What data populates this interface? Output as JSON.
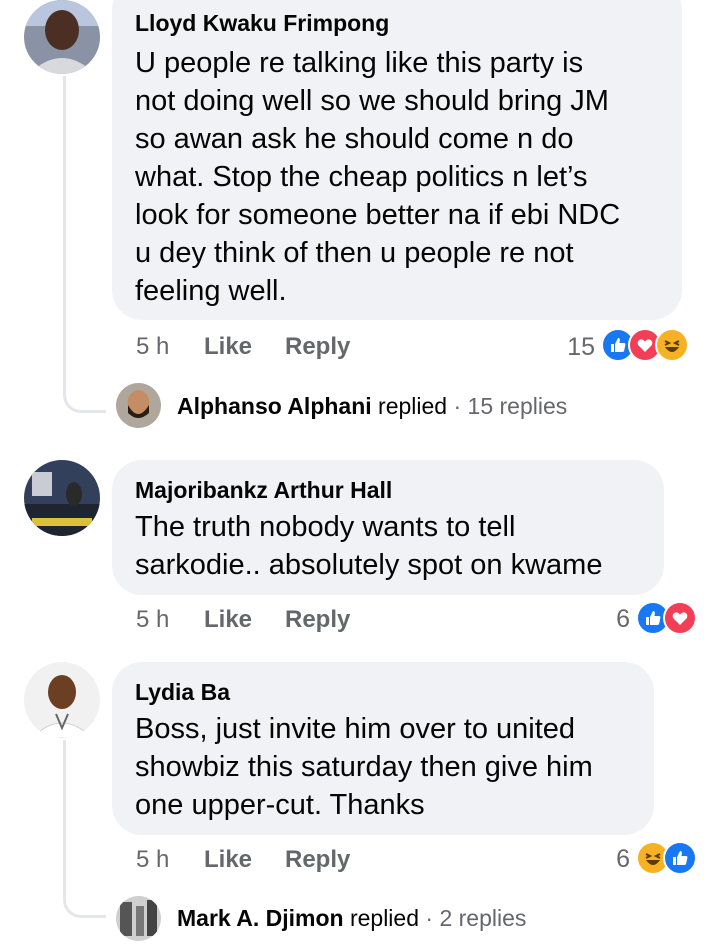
{
  "comments": [
    {
      "author": "Lloyd Kwaku Frimpong",
      "lines": [
        "U people re talking like this party is",
        "not doing well so we should bring JM",
        "so awan ask he should  come n do",
        "what. Stop the cheap politics n let’s",
        "look for someone better na if ebi NDC",
        "u dey think of then u people re not",
        "feeling well."
      ],
      "time": "5 h",
      "like_label": "Like",
      "reply_label": "Reply",
      "reaction_count": "15",
      "reactions": [
        "like",
        "love",
        "haha"
      ],
      "reply_summary": {
        "name": "Alphanso Alphani",
        "action": "replied",
        "separator": "·",
        "count": "15 replies"
      }
    },
    {
      "author": "Majoribankz Arthur Hall",
      "lines": [
        "The truth nobody wants to tell",
        "sarkodie.. absolutely spot on kwame"
      ],
      "time": "5 h",
      "like_label": "Like",
      "reply_label": "Reply",
      "reaction_count": "6",
      "reactions": [
        "like",
        "love"
      ]
    },
    {
      "author": "Lydia Ba",
      "lines": [
        "Boss, just invite him over to united",
        "showbiz this saturday then give him",
        "one upper-cut. Thanks"
      ],
      "time": "5 h",
      "like_label": "Like",
      "reply_label": "Reply",
      "reaction_count": "6",
      "reactions": [
        "haha",
        "like"
      ],
      "reply_summary": {
        "name": "Mark A. Djimon",
        "action": "replied",
        "separator": "·",
        "count": "2 replies"
      }
    }
  ],
  "colors": {
    "bubble": "#f0f2f5",
    "meta": "#65676b",
    "like": "#1877f2",
    "love": "#f33e58",
    "haha": "#f7b125"
  }
}
